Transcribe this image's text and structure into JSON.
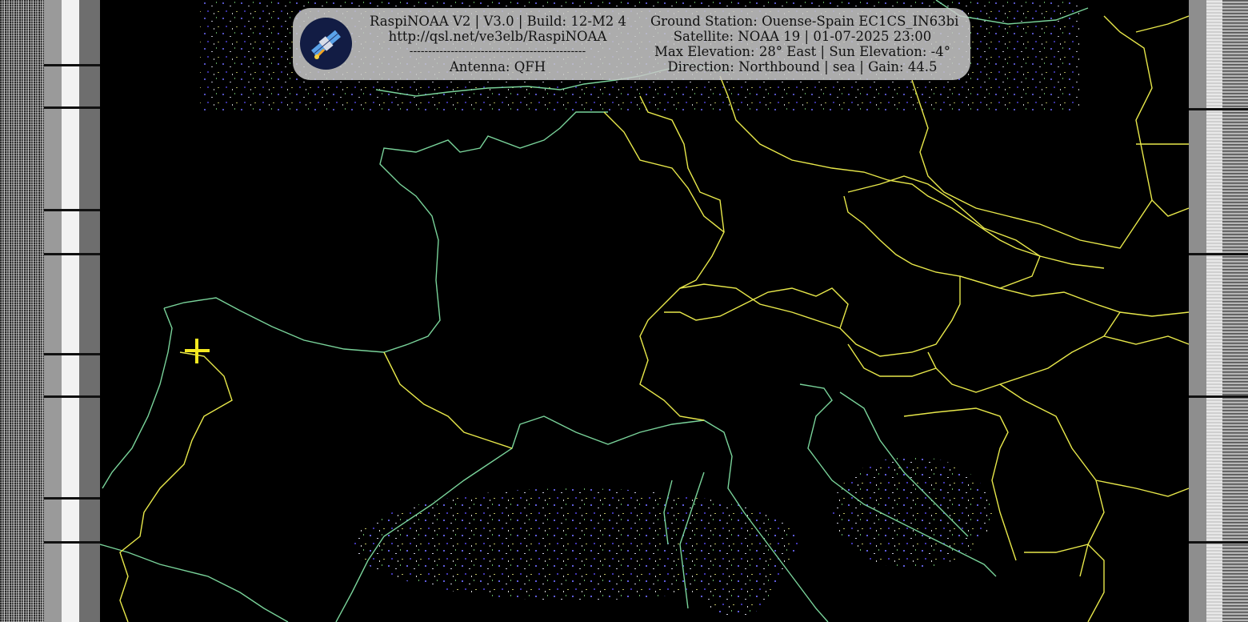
{
  "header": {
    "left": {
      "title": "RaspiNOAA V2 | V3.0 | Build: 12-M2 4",
      "url": "http://qsl.net/ve3elb/RaspiNOAA",
      "separator": "-----------------------------------------------",
      "antenna": "Antenna: QFH"
    },
    "right": {
      "ground_station": "Ground Station: Ouense-Spain EC1CS_IN63bi",
      "satellite": "Satellite: NOAA 19 | 01-07-2025 23:00",
      "elevation": "Max Elevation: 28° East | Sun Elevation: -4°",
      "direction": "Direction: Northbound | sea | Gain: 44.5"
    },
    "logo_icon": "satellite-icon"
  },
  "image": {
    "colors": {
      "coastline": "#79d39a",
      "borders": "#e8e84a",
      "location_marker": "#f3e820",
      "background": "#000000"
    },
    "location_marker_icon": "plus-marker-icon"
  }
}
